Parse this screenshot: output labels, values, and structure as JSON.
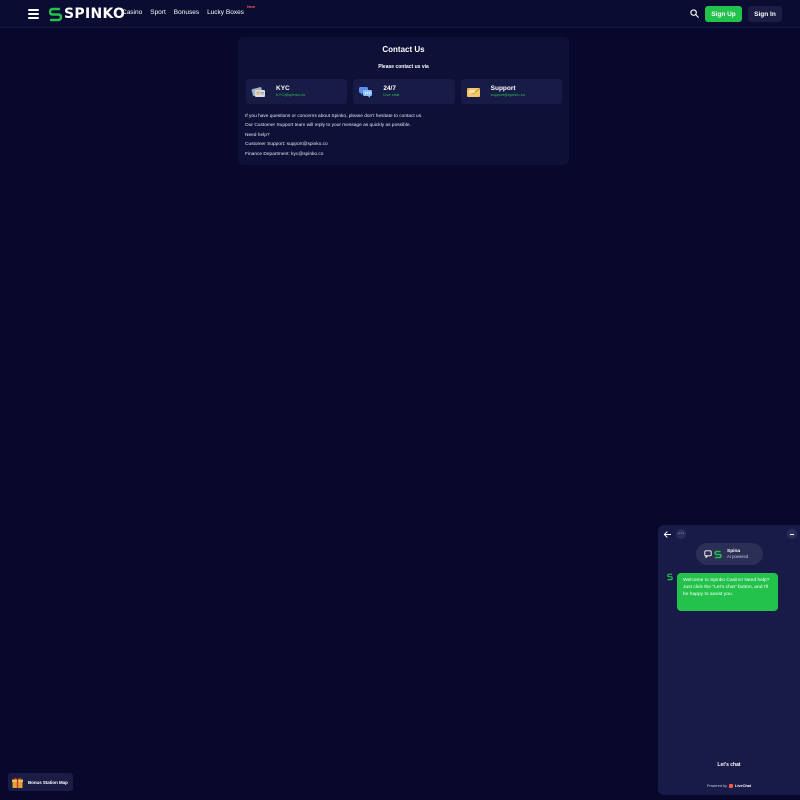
{
  "header": {
    "logo_text": "SPINKO",
    "nav": [
      {
        "label": "Casino"
      },
      {
        "label": "Sport"
      },
      {
        "label": "Bonuses"
      },
      {
        "label": "Lucky Boxes",
        "badge": "New"
      }
    ],
    "signup_label": "Sign Up",
    "signin_label": "Sign In"
  },
  "contact": {
    "title": "Contact Us",
    "subtitle": "Please contact us via",
    "channels": [
      {
        "name": "KYC",
        "sub": "KYC@spinko.co",
        "icon": "id-cards-icon"
      },
      {
        "name": "24/7",
        "sub": "Live chat",
        "icon": "chat-bubbles-icon"
      },
      {
        "name": "Support",
        "sub": "support@spinko.co",
        "icon": "envelope-icon"
      }
    ],
    "body_lines": [
      "If you have questions or concerns about Spinko, please don't hesitate to contact us.",
      "Our Customer Support team will reply to your message as quickly as possible.",
      "Need help?",
      "Customer Support: support@spinko.co",
      "Finance Department: kyc@spinko.co"
    ]
  },
  "chat": {
    "agent_name": "Spina",
    "agent_sub": "AI powered",
    "message": "Welcome to Spinko Casino! Need help? Just click the \"Let's chat\" button, and I'll be happy to assist you.",
    "lets_chat_label": "Let's chat",
    "powered_prefix": "Powered by",
    "powered_brand": "LiveChat"
  },
  "bonus": {
    "label": "Bonus Station Map"
  },
  "colors": {
    "background": "#07082b",
    "accent_green": "#23c24a",
    "card": "#0e1038"
  }
}
